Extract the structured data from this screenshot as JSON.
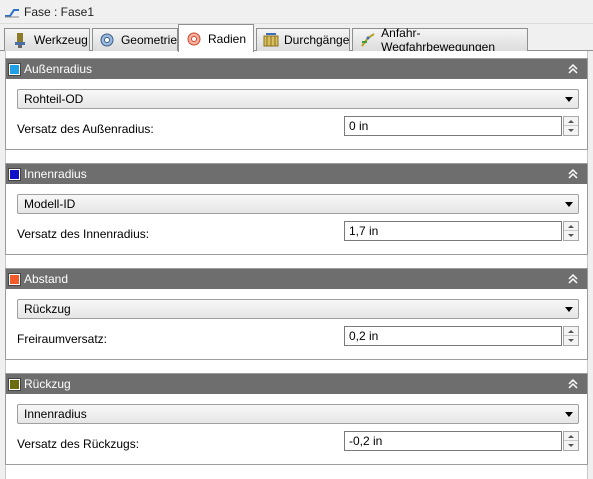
{
  "window": {
    "title": "Fase : Fase1",
    "icon": "chamfer-op-icon"
  },
  "tabs": [
    {
      "label": "Werkzeug",
      "icon": "tool-icon",
      "active": false
    },
    {
      "label": "Geometrie",
      "icon": "geometry-icon",
      "active": false
    },
    {
      "label": "Radien",
      "icon": "radii-icon",
      "active": true
    },
    {
      "label": "Durchgänge",
      "icon": "passes-icon",
      "active": false
    },
    {
      "label": "Anfahr-Wegfahrbewegungen",
      "icon": "linking-icon",
      "active": false
    }
  ],
  "sections": [
    {
      "title": "Außenradius",
      "color": "#1f9fe6",
      "dropdown": "Rohteil-OD",
      "field_label": "Versatz des Außenradius:",
      "field_value": "0 in"
    },
    {
      "title": "Innenradius",
      "color": "#1010c8",
      "dropdown": "Modell-ID",
      "field_label": "Versatz des Innenradius:",
      "field_value": "1,7 in"
    },
    {
      "title": "Abstand",
      "color": "#f25a2a",
      "dropdown": "Rückzug",
      "field_label": "Freiraumversatz:",
      "field_value": "0,2 in"
    },
    {
      "title": "Rückzug",
      "color": "#6b6b10",
      "dropdown": "Innenradius",
      "field_label": "Versatz des Rückzugs:",
      "field_value": "-0,2 in"
    }
  ]
}
